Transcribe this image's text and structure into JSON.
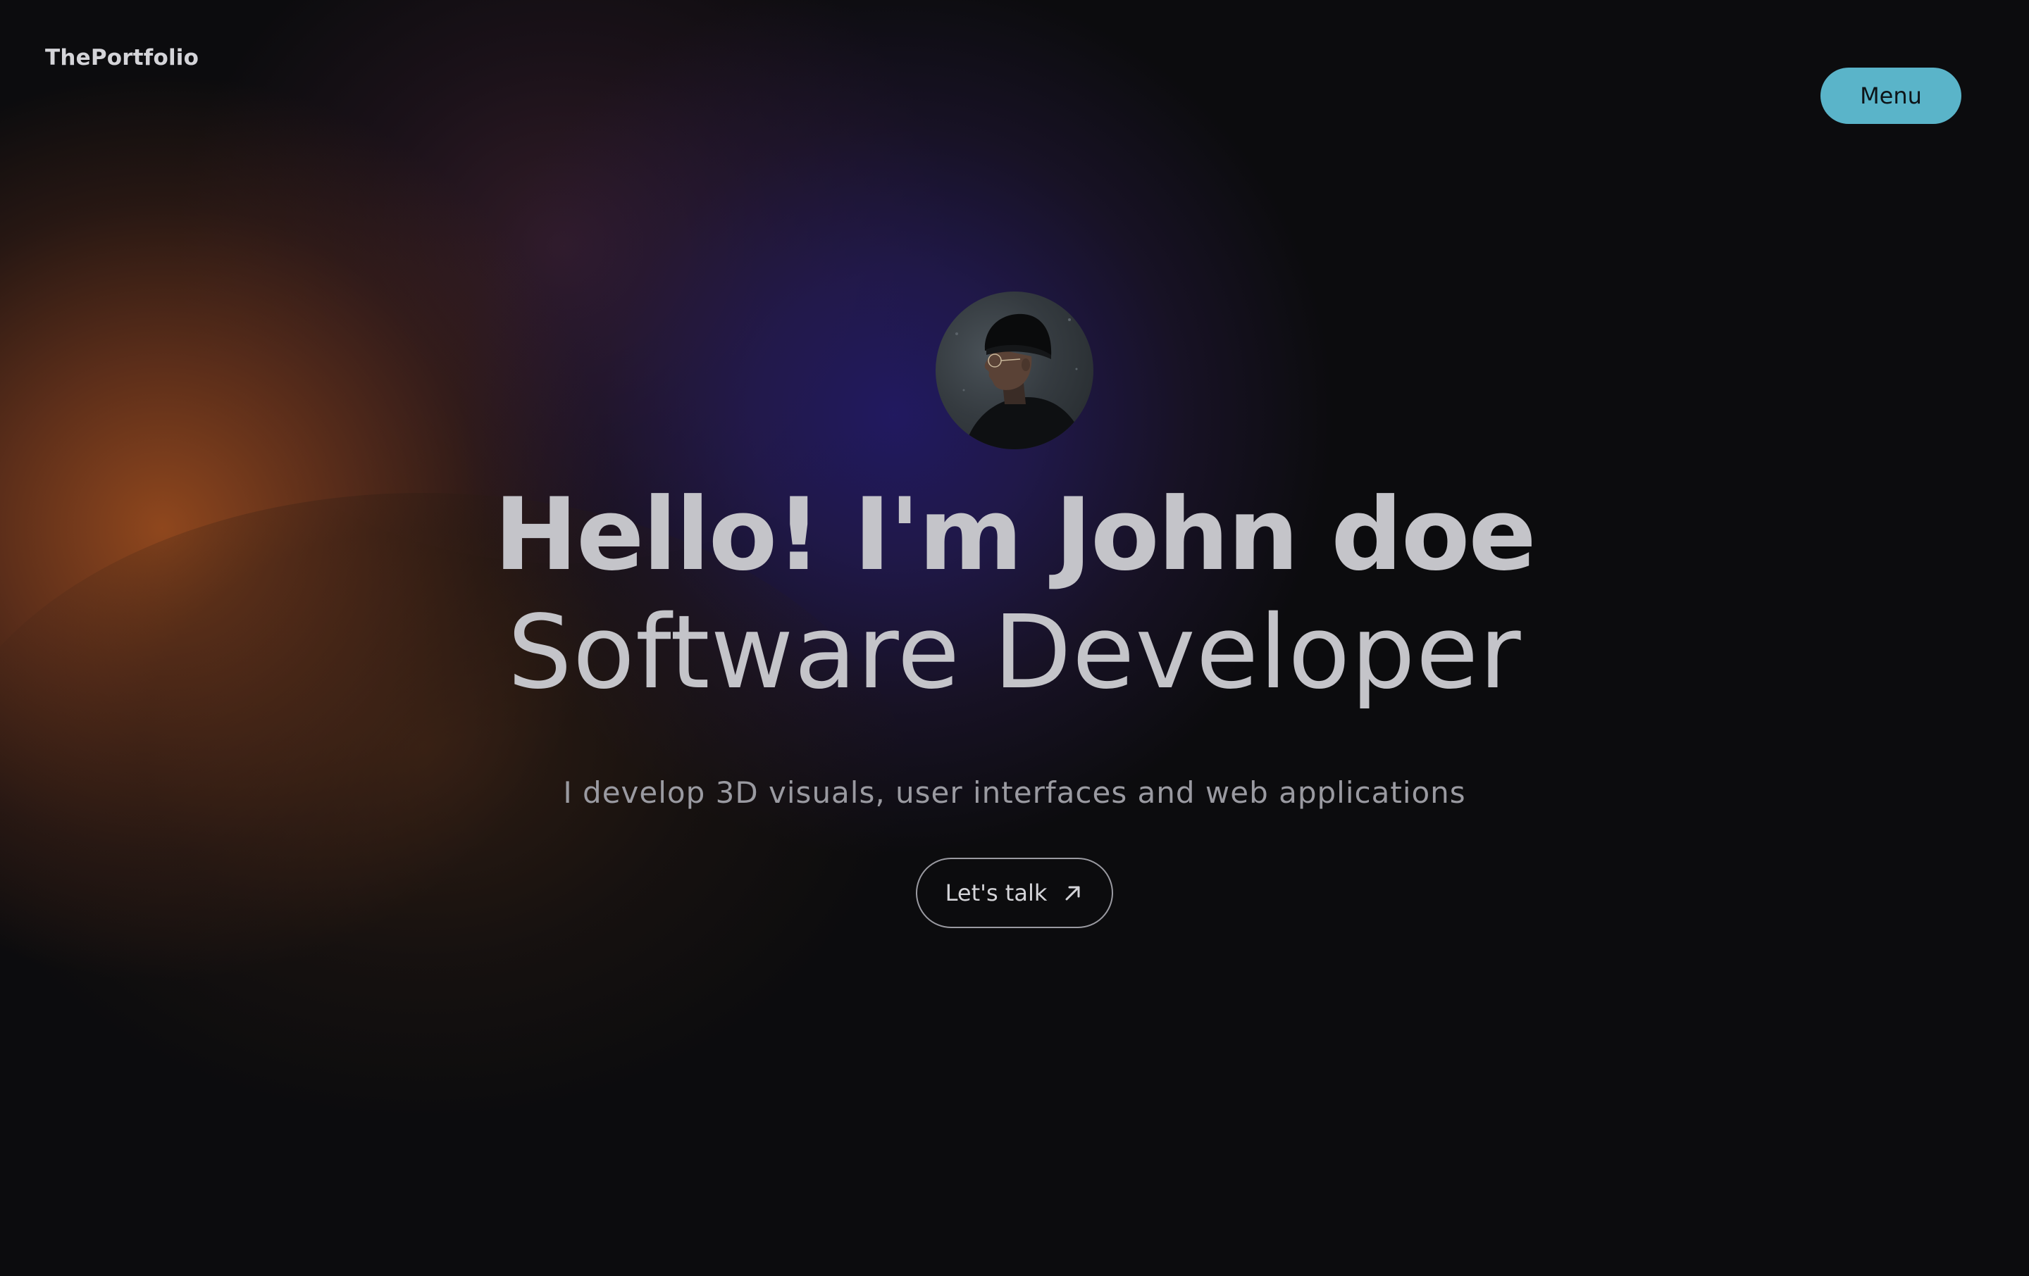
{
  "header": {
    "logo": "ThePortfolio",
    "menu_label": "Menu"
  },
  "hero": {
    "avatar_alt": "avatar",
    "headline": "Hello! I'm John doe",
    "subheadline": "Software Developer",
    "tagline": "I develop 3D visuals, user interfaces and web applications",
    "cta_label": "Let's talk",
    "cta_icon": "arrow-up-right-icon"
  },
  "colors": {
    "background": "#0c0c0e",
    "menu_button": "#5ab4c9",
    "text": "#c4c4c9",
    "accent_orange": "#964a1e",
    "accent_purple": "#221a64"
  }
}
